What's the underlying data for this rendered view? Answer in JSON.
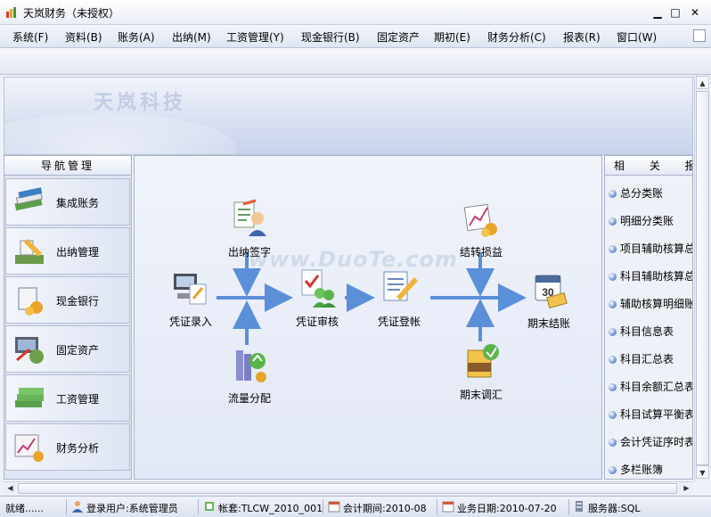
{
  "window": {
    "title": "天岚财务（未授权）",
    "controls": {
      "minimize": "▁",
      "maximize": "□",
      "close": "✕"
    }
  },
  "menu": [
    "系统(F)",
    "资料(B)",
    "账务(A)",
    "出纳(M)",
    "工资管理(Y)",
    "现金银行(B)",
    "固定资产",
    "期初(E)",
    "财务分析(C)",
    "报表(R)",
    "窗口(W)"
  ],
  "banner": {
    "logo": "天岚科技"
  },
  "nav": {
    "header": "导航管理",
    "items": [
      {
        "label": "集成账务",
        "icon": "books-icon"
      },
      {
        "label": "出纳管理",
        "icon": "cashier-icon"
      },
      {
        "label": "现金银行",
        "icon": "bank-icon"
      },
      {
        "label": "固定资产",
        "icon": "computer-asset-icon"
      },
      {
        "label": "工资管理",
        "icon": "money-stack-icon"
      },
      {
        "label": "财务分析",
        "icon": "analysis-chart-icon"
      }
    ]
  },
  "flow": {
    "watermark": "www.DuoTe.com",
    "nodes": {
      "voucher_entry": "凭证录入",
      "cashier_sign": "出纳签字",
      "cash_flow": "流量分配",
      "voucher_audit": "凭证审核",
      "voucher_post": "凭证登帐",
      "transfer_pl": "结转损益",
      "period_adjust": "期末调汇",
      "period_close": "期末结账"
    }
  },
  "related": {
    "header": "相 关 报",
    "items": [
      "总分类账",
      "明细分类账",
      "项目辅助核算总",
      "科目辅助核算总",
      "辅助核算明细账",
      "科目信息表",
      "科目汇总表",
      "科目余额汇总表",
      "科目试算平衡表",
      "会计凭证序时表",
      "多栏账簿"
    ]
  },
  "status": {
    "ready": "就绪......",
    "user": "登录用户:系统管理员",
    "account": "帐套:TLCW_2010_001",
    "period": "会计期间:2010-08",
    "biz_date": "业务日期:2010-07-20",
    "server": "服务器:SQL"
  }
}
